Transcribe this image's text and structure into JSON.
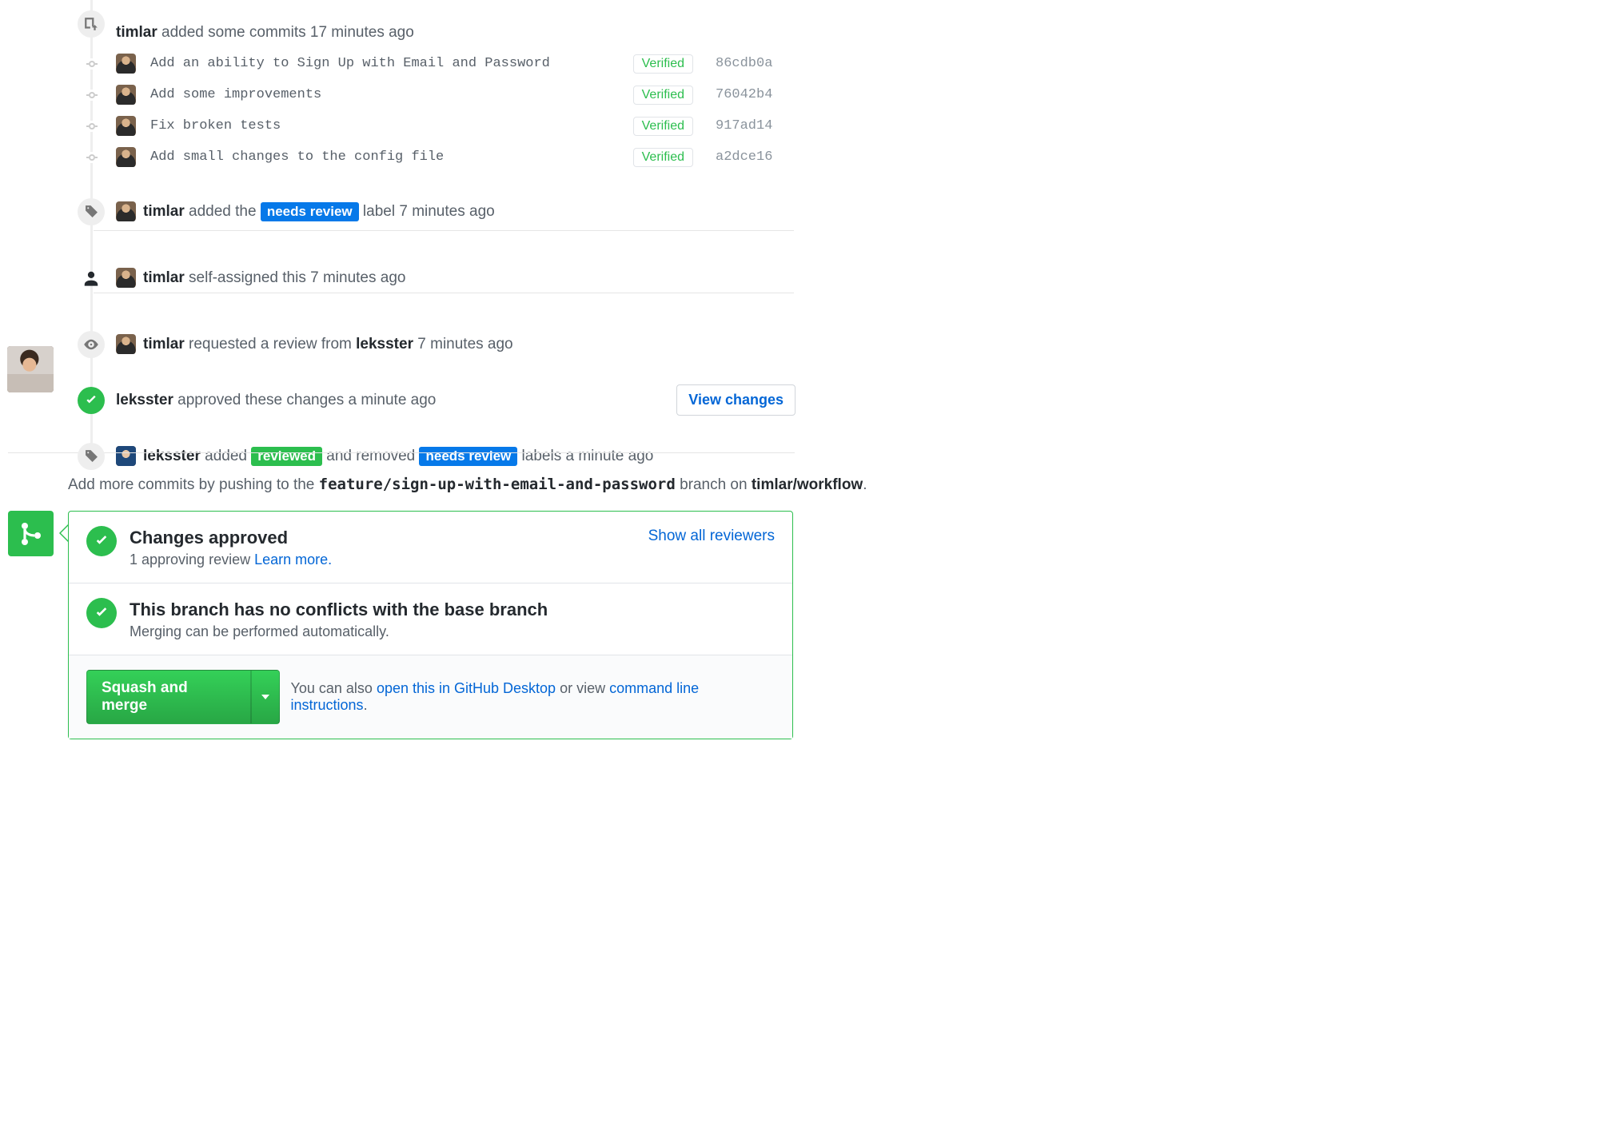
{
  "timeline": {
    "push_header": {
      "user": "timlar",
      "verb": "added some commits",
      "time": "17 minutes ago"
    },
    "commits": [
      {
        "msg": "Add an ability to Sign Up with Email and Password",
        "verified": "Verified",
        "sha": "86cdb0a"
      },
      {
        "msg": "Add some improvements",
        "verified": "Verified",
        "sha": "76042b4"
      },
      {
        "msg": "Fix broken tests",
        "verified": "Verified",
        "sha": "917ad14"
      },
      {
        "msg": "Add small changes to the config file",
        "verified": "Verified",
        "sha": "a2dce16"
      }
    ],
    "label_added": {
      "user": "timlar",
      "pre": "added the",
      "label": "needs review",
      "post": "label",
      "time": "7 minutes ago"
    },
    "self_assign": {
      "user": "timlar",
      "text": "self-assigned this",
      "time": "7 minutes ago"
    },
    "review_requested": {
      "user": "timlar",
      "pre": "requested a review from",
      "target": "leksster",
      "time": "7 minutes ago"
    },
    "approved": {
      "user": "leksster",
      "text": "approved these changes",
      "time": "a minute ago",
      "button": "View changes"
    },
    "label_swap": {
      "user": "leksster",
      "added_pre": "added",
      "added_label": "reviewed",
      "mid": "and removed",
      "removed_label": "needs review",
      "post": "labels",
      "time": "a minute ago"
    }
  },
  "pushline": {
    "pre": "Add more commits by pushing to the",
    "branch": "feature/sign-up-with-email-and-password",
    "mid": "branch on",
    "repo": "timlar/workflow",
    "end": "."
  },
  "merge": {
    "approved_title": "Changes approved",
    "approved_sub_pre": "1 approving review ",
    "approved_sub_link": "Learn more.",
    "show_reviewers": "Show all reviewers",
    "noconflict_title": "This branch has no conflicts with the base branch",
    "noconflict_sub": "Merging can be performed automatically.",
    "button": "Squash and merge",
    "footer_pre": "You can also ",
    "footer_link1": "open this in GitHub Desktop",
    "footer_mid": " or view ",
    "footer_link2": "command line instructions",
    "footer_end": "."
  }
}
